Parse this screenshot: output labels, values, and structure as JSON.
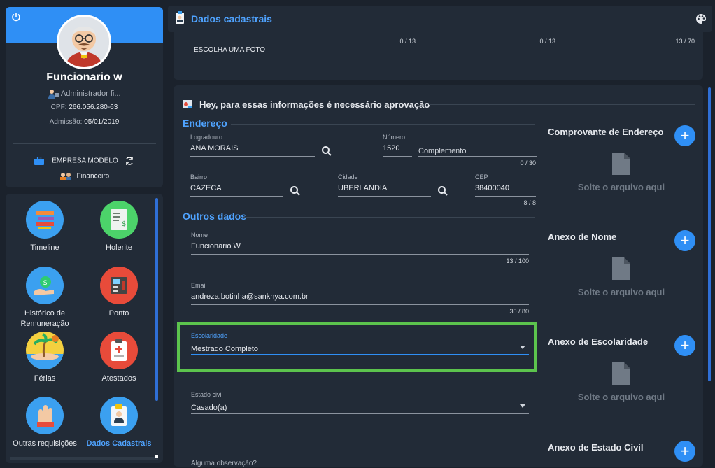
{
  "profile": {
    "name": "Funcionario w",
    "role": "Administrador fi...",
    "cpf_label": "CPF:",
    "cpf": "266.056.280-63",
    "admission_label": "Admissão:",
    "admission": "05/01/2019",
    "company": "EMPRESA MODELO",
    "department": "Financeiro"
  },
  "menu": [
    {
      "label": "Timeline",
      "icon": "timeline-icon"
    },
    {
      "label": "Holerite",
      "icon": "payslip-icon"
    },
    {
      "label": "Histórico de Remuneração",
      "icon": "salary-history-icon"
    },
    {
      "label": "Ponto",
      "icon": "time-clock-icon"
    },
    {
      "label": "Férias",
      "icon": "vacation-icon"
    },
    {
      "label": "Atestados",
      "icon": "medical-certificate-icon"
    },
    {
      "label": "Outras requisições",
      "icon": "requests-icon"
    },
    {
      "label": "Dados Cadastrais",
      "icon": "registration-data-icon",
      "active": true
    }
  ],
  "header": {
    "title": "Dados cadastrais"
  },
  "top_card": {
    "photo_label": "ESCOLHA UMA FOTO",
    "counter_1": "0 / 13",
    "counter_2": "0 / 13",
    "counter_3": "13 / 70"
  },
  "approval_notice": "Hey, para essas informações é necessário aprovação",
  "address": {
    "section_title": "Endereço",
    "logradouro_label": "Logradouro",
    "logradouro": "ANA MORAIS",
    "numero_label": "Número",
    "numero": "1520",
    "complemento_placeholder": "Complemento",
    "complemento_counter": "0 / 30",
    "bairro_label": "Bairro",
    "bairro": "CAZECA",
    "cidade_label": "Cidade",
    "cidade": "UBERLANDIA",
    "cep_label": "CEP",
    "cep": "38400040",
    "cep_counter": "8 / 8"
  },
  "other": {
    "section_title": "Outros dados",
    "nome_label": "Nome",
    "nome": "Funcionario W",
    "nome_counter": "13 / 100",
    "email_label": "Email",
    "email": "andreza.botinha@sankhya.com.br",
    "email_counter": "30 / 80",
    "escolaridade_label": "Escolaridade",
    "escolaridade": "Mestrado Completo",
    "estado_civil_label": "Estado civil",
    "estado_civil": "Casado(a)",
    "obs_label": "Alguma observação?"
  },
  "attachments": [
    {
      "title": "Comprovante de Endereço",
      "drop": "Solte o arquivo aqui"
    },
    {
      "title": "Anexo de Nome",
      "drop": "Solte o arquivo aqui"
    },
    {
      "title": "Anexo de Escolaridade",
      "drop": "Solte o arquivo aqui"
    },
    {
      "title": "Anexo de Estado Civil",
      "drop": ""
    }
  ],
  "colors": {
    "accent": "#2f8ff5",
    "highlight": "#5cc44d",
    "panel": "#222b37",
    "background": "#1b222c"
  }
}
